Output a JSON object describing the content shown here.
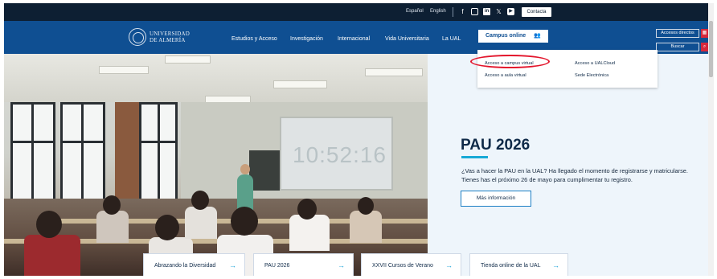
{
  "topbar": {
    "languages": [
      "Español",
      "English"
    ],
    "social_icons": [
      "facebook-icon",
      "instagram-icon",
      "linkedin-icon",
      "x-icon",
      "youtube-icon"
    ],
    "contact_label": "Contacta"
  },
  "nav": {
    "logo_line1": "UNIVERSIDAD",
    "logo_line2": "DE ALMERÍA",
    "items": [
      "Estudios y Acceso",
      "Investigación",
      "Internacional",
      "Vida Universitaria",
      "La UAL"
    ],
    "campus_online_label": "Campus online",
    "accesos_directos_label": "Accesos directos",
    "buscar_label": "Buscar"
  },
  "dropdown": {
    "items": [
      "Acceso a campus virtual",
      "Acceso a UALCloud",
      "Acceso a aula virtual",
      "Sede Electrónica"
    ]
  },
  "hero": {
    "board_clock": "10:52:16",
    "title": "PAU 2026",
    "description": "¿Vas a hacer la PAU en la UAL? Ha llegado el momento de registrarse y matricularse. Tienes has el próximo 26 de mayo para cumplimentar tu registro.",
    "more_label": "Más información"
  },
  "cards": [
    "Abrazando la Diversidad",
    "PAU 2026",
    "XXVII Cursos de Verano",
    "Tienda online de la UAL"
  ],
  "colors": {
    "topbar": "#0d1f33",
    "nav": "#0f4f92",
    "accent": "#17a9d6",
    "highlight": "#e3142b"
  }
}
